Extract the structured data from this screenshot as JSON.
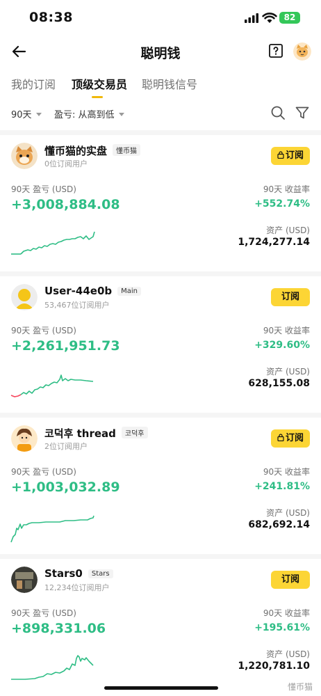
{
  "status": {
    "time": "08:38",
    "battery": "82"
  },
  "header": {
    "title": "聪明钱"
  },
  "tabs": [
    {
      "label": "我的订阅"
    },
    {
      "label": "顶级交易员"
    },
    {
      "label": "聪明钱信号"
    }
  ],
  "filters": {
    "period": "90天",
    "sort": "盈亏: 从高到低"
  },
  "labels": {
    "pnl": "90天 盈亏 (USD)",
    "roi": "90天 收益率",
    "assets": "资产 (USD)",
    "subscribe": "订阅"
  },
  "colors": {
    "accent": "#fcd535",
    "positive": "#2ebd85",
    "negative": "#f6465d"
  },
  "traders": [
    {
      "name": "懂币猫的实盘",
      "tag": "懂币猫",
      "subscribers": "0位订阅用户",
      "locked": true,
      "pnl": "+3,008,884.08",
      "roi": "+552.74%",
      "assets": "1,724,277.14"
    },
    {
      "name": "User-44e0b",
      "tag": "Main",
      "subscribers": "53,467位订阅用户",
      "locked": false,
      "pnl": "+2,261,951.73",
      "roi": "+329.60%",
      "assets": "628,155.08"
    },
    {
      "name": "코덕후 thread",
      "tag": "코덕후",
      "subscribers": "2位订阅用户",
      "locked": true,
      "pnl": "+1,003,032.89",
      "roi": "+241.81%",
      "assets": "682,692.14"
    },
    {
      "name": "Stars0",
      "tag": "Stars",
      "subscribers": "12,234位订阅用户",
      "locked": false,
      "pnl": "+898,331.06",
      "roi": "+195.61%",
      "assets": "1,220,781.10"
    }
  ],
  "watermark": "懂币猫"
}
